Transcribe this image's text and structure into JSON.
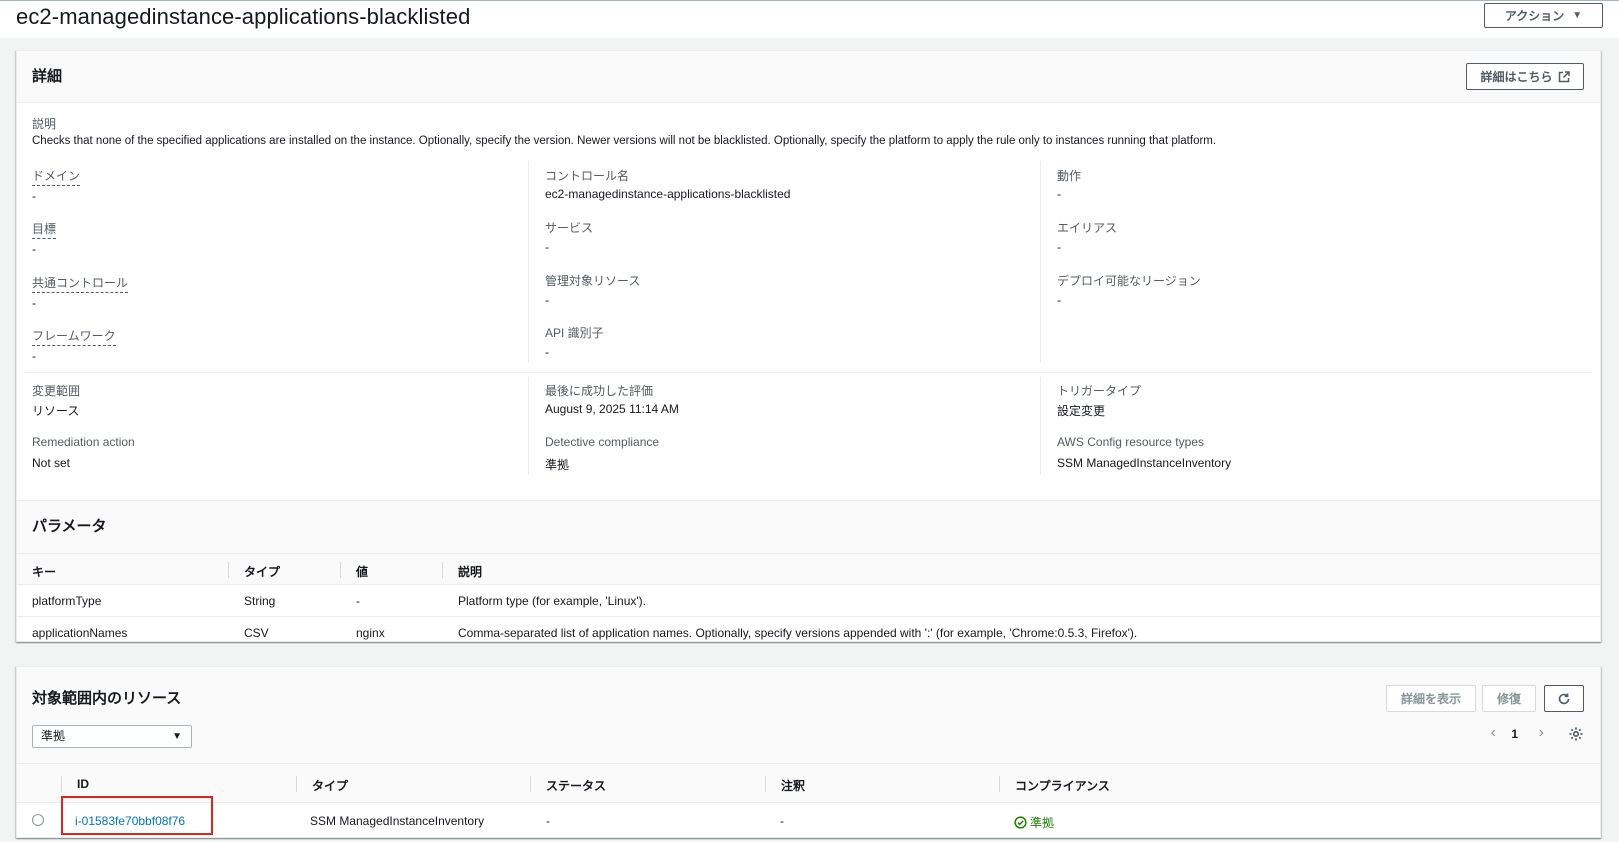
{
  "header": {
    "title": "ec2-managedinstance-applications-blacklisted",
    "actions_label": "アクション"
  },
  "details": {
    "title": "詳細",
    "learn_more_label": "詳細はこちら",
    "description_label": "説明",
    "description": "Checks that none of the specified applications are installed on the instance. Optionally, specify the version. Newer versions will not be blacklisted. Optionally, specify the platform to apply the rule only to instances running that platform.",
    "col1": [
      {
        "label": "ドメイン",
        "value": "-"
      },
      {
        "label": "目標",
        "value": "-"
      },
      {
        "label": "共通コントロール",
        "value": "-"
      },
      {
        "label": "フレームワーク",
        "value": "-"
      }
    ],
    "col2": [
      {
        "label": "コントロール名",
        "value": "ec2-managedinstance-applications-blacklisted"
      },
      {
        "label": "サービス",
        "value": "-"
      },
      {
        "label": "管理対象リソース",
        "value": "-"
      },
      {
        "label": "API 識別子",
        "value": "-"
      }
    ],
    "col3": [
      {
        "label": "動作",
        "value": "-"
      },
      {
        "label": "エイリアス",
        "value": "-"
      },
      {
        "label": "デプロイ可能なリージョン",
        "value": "-"
      }
    ],
    "lower": [
      [
        {
          "label": "変更範囲",
          "value": "リソース"
        },
        {
          "label": "Remediation action",
          "value": "Not set"
        }
      ],
      [
        {
          "label": "最後に成功した評価",
          "value": "August 9, 2025 11:14 AM"
        },
        {
          "label": "Detective compliance",
          "value": "準拠"
        }
      ],
      [
        {
          "label": "トリガータイプ",
          "value": "設定変更"
        },
        {
          "label": "AWS Config resource types",
          "value": "SSM ManagedInstanceInventory"
        }
      ]
    ]
  },
  "parameters": {
    "title": "パラメータ",
    "columns": [
      "キー",
      "タイプ",
      "値",
      "説明"
    ],
    "rows": [
      [
        "platformType",
        "String",
        "-",
        "Platform type (for example, 'Linux')."
      ],
      [
        "applicationNames",
        "CSV",
        "nginx",
        "Comma-separated list of application names. Optionally, specify versions appended with ':' (for example, 'Chrome:0.5.3, Firefox')."
      ]
    ]
  },
  "resources": {
    "title": "対象範囲内のリソース",
    "view_details_label": "詳細を表示",
    "remediate_label": "修復",
    "filter_value": "準拠",
    "page": "1",
    "columns": [
      "ID",
      "タイプ",
      "ステータス",
      "注釈",
      "コンプライアンス"
    ],
    "rows": [
      {
        "id": "i-01583fe70bbf08f76",
        "type": "SSM ManagedInstanceInventory",
        "status": "-",
        "annotation": "-",
        "compliance": "準拠"
      }
    ]
  },
  "colors": {
    "link": "#0073bb",
    "success": "#1d8102",
    "highlight": "#e0231b"
  }
}
